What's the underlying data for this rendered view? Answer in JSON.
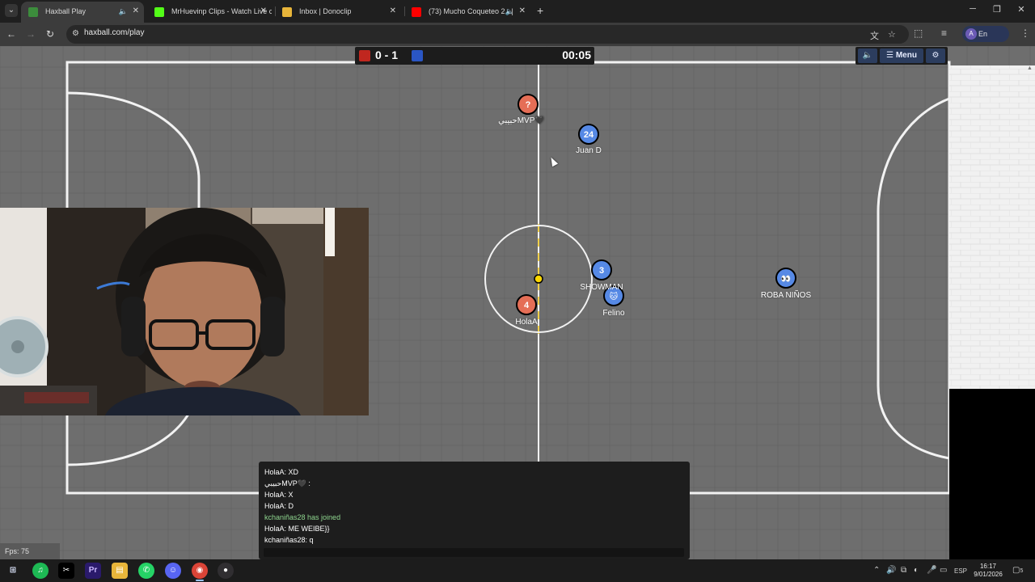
{
  "browser": {
    "tabs": [
      {
        "title": "Haxball Play",
        "active": true,
        "favicon_color": "#3c8c3c",
        "muted": true
      },
      {
        "title": "MrHuevinp Clips - Watch Live c",
        "active": false,
        "favicon_color": "#53fc18"
      },
      {
        "title": "Inbox | Donoclip",
        "active": false,
        "favicon_color": "#e8b53a"
      },
      {
        "title": "(73) Mucho Coqueteo 2 - |",
        "active": false,
        "favicon_color": "#ff0000",
        "muted": true
      }
    ],
    "url": "haxball.com/play",
    "profile_initial": "A",
    "profile_label": "En pausa"
  },
  "game": {
    "score": "0 - 1",
    "time": "00:05",
    "menu_label": "Menu",
    "team_colors": {
      "red": "#c0271f",
      "blue": "#2a56c4"
    },
    "players": [
      {
        "name": "حبيبيMVP🖤",
        "avatar": "?",
        "team": "red"
      },
      {
        "name": "Juan D",
        "avatar": "24",
        "team": "blue"
      },
      {
        "name": "SHOWMAN",
        "avatar": "3",
        "team": "blue"
      },
      {
        "name": "Felino",
        "avatar": "🐱",
        "team": "blue"
      },
      {
        "name": "HolaA",
        "avatar": "4",
        "team": "red"
      },
      {
        "name": "ROBA NIÑOS",
        "avatar": "👀",
        "team": "blue"
      }
    ],
    "ball_color": "#ffd700",
    "chat": [
      {
        "text": "HolaA: XD",
        "system": false
      },
      {
        "text": "حبيبيMVP🖤 :",
        "system": false
      },
      {
        "text": "HolaA: X",
        "system": false
      },
      {
        "text": "HolaA: D",
        "system": false
      },
      {
        "text": "kchaniñas28 has joined",
        "system": true
      },
      {
        "text": "HolaA: ME WEIBE}}",
        "system": false
      },
      {
        "text": "kchaniñas28: q",
        "system": false
      }
    ],
    "fps_label": "Fps: 75"
  },
  "taskbar": {
    "apps": [
      "start-icon",
      "spotify-icon",
      "capcut-icon",
      "premiere-icon",
      "file-explorer-icon",
      "whatsapp-icon",
      "discord-icon",
      "chrome-icon",
      "obs-icon"
    ],
    "language": "ESP",
    "time": "16:17",
    "date": "9/01/2026",
    "notification_count": "5"
  }
}
